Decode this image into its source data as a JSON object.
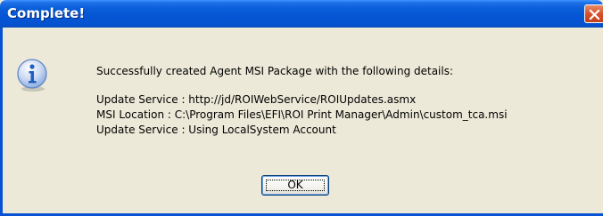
{
  "window": {
    "title": "Complete!",
    "close_icon": "close-icon"
  },
  "dialog": {
    "icon": "info-icon",
    "lines": [
      "Successfully created Agent MSI Package with the following details:",
      "Update Service : http://jd/ROIWebService/ROIUpdates.asmx",
      "MSI Location : C:\\Program Files\\EFI\\ROI Print Manager\\Admin\\custom_tca.msi",
      "Update Service :  Using LocalSystem Account"
    ],
    "ok_label": "OK"
  },
  "colors": {
    "titlebar": "#0555d4",
    "close_button": "#d8502a",
    "dialog_face": "#ece9d8",
    "info_icon": "#1f5fbf"
  }
}
